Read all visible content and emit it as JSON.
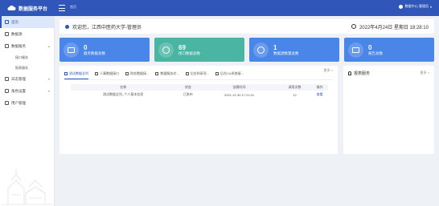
{
  "app": {
    "title": "数据服务平台"
  },
  "header": {
    "tab_home": "首页",
    "user_name": "数据中心-管理员"
  },
  "sidebar": {
    "items": [
      {
        "label": "首页",
        "active": true
      },
      {
        "label": "数据源",
        "active": false
      },
      {
        "label": "数据服务",
        "active": false
      },
      {
        "label": "日志管理",
        "active": false
      },
      {
        "label": "角色设置",
        "active": false
      },
      {
        "label": "用户管理",
        "active": false
      }
    ],
    "sub_items": [
      "接口服务",
      "报表服务"
    ]
  },
  "welcome": {
    "text": "欢迎您，江西中医药大学-管理员",
    "datetime": "2022年4月24日 星期日 18:28:10"
  },
  "stats": [
    {
      "value": "0",
      "label": "服务数据总数",
      "icon": "monitor-icon",
      "color": "#4a86e8"
    },
    {
      "value": "69",
      "label": "接口数据总数",
      "icon": "link-icon",
      "color": "#4ab5a3"
    },
    {
      "value": "1",
      "label": "数据源数量总数",
      "icon": "database-icon",
      "color": "#4a86e8"
    },
    {
      "value": "0",
      "label": "报告总数",
      "icon": "report-icon",
      "color": "#4a86e8"
    }
  ],
  "main_panel": {
    "more": "更多 >",
    "tabs": [
      "测试数据全列",
      "人事数据接口",
      "财务数据接...",
      "数据服务对...",
      "后台科研项...",
      "后台CA系统接..."
    ],
    "columns": [
      "名称",
      "状态",
      "创建时间",
      "调用次数",
      "操作"
    ],
    "rows": [
      {
        "name": "测试数据全列_个人基本信息",
        "status": "已发布",
        "created": "2021-12-30 17:21:01",
        "calls": "12",
        "action": "查看"
      }
    ]
  },
  "right_panel": {
    "title": "报表服务",
    "more": "更多 >"
  }
}
